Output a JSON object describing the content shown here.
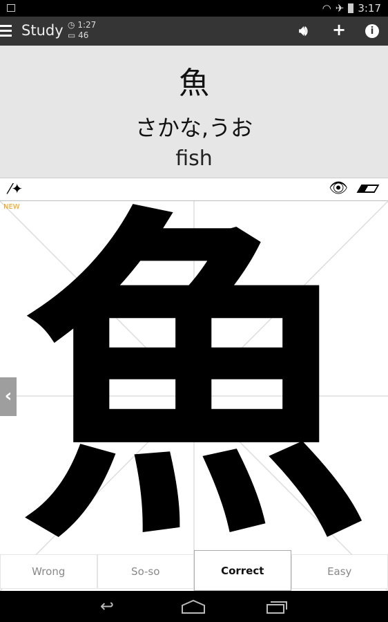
{
  "status": {
    "time": "3:17",
    "icons": [
      "image-icon",
      "wifi-icon",
      "airplane-icon",
      "battery-icon"
    ]
  },
  "toolbar": {
    "title": "Study",
    "timer": "1:27",
    "count": "46"
  },
  "card": {
    "kanji": "魚",
    "reading": "さかな,うお",
    "meaning": "fish"
  },
  "canvas": {
    "badge": "NEW",
    "character": "魚"
  },
  "grades": [
    {
      "label": "Wrong"
    },
    {
      "label": "So-so"
    },
    {
      "label": "Correct",
      "selected": true
    },
    {
      "label": "Easy"
    }
  ]
}
